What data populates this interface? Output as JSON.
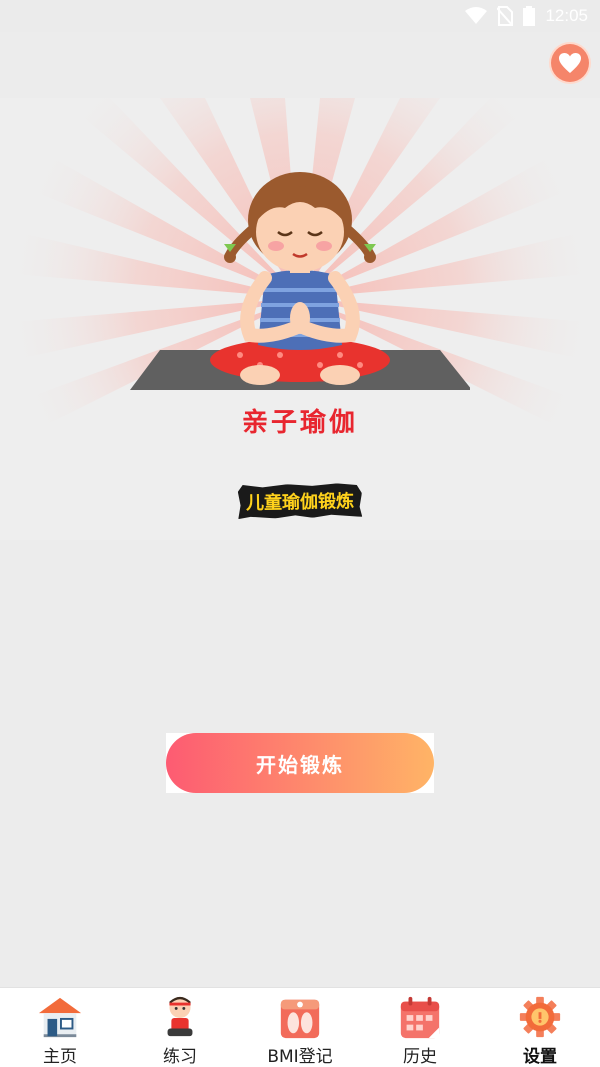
{
  "status_bar": {
    "time": "12:05",
    "icons": [
      "wifi-icon",
      "no-sim-icon",
      "battery-icon"
    ]
  },
  "hero": {
    "title": "亲子瑜伽",
    "subtitle": "儿童瑜伽锻炼",
    "favorite_icon": "heart-icon",
    "illustration": "girl-yoga-illustration"
  },
  "start_button": {
    "label": "开始锻炼"
  },
  "colors": {
    "title": "#e8262f",
    "button_gradient_start": "#fd5b72",
    "button_gradient_end": "#ffb466",
    "favorite": "#f5856a"
  },
  "bottom_nav": {
    "items": [
      {
        "label": "主页",
        "icon": "home-icon"
      },
      {
        "label": "练习",
        "icon": "practice-icon"
      },
      {
        "label": "BMI登记",
        "icon": "scale-icon"
      },
      {
        "label": "历史",
        "icon": "calendar-icon"
      },
      {
        "label": "设置",
        "icon": "gear-icon"
      }
    ],
    "active": "设置"
  }
}
